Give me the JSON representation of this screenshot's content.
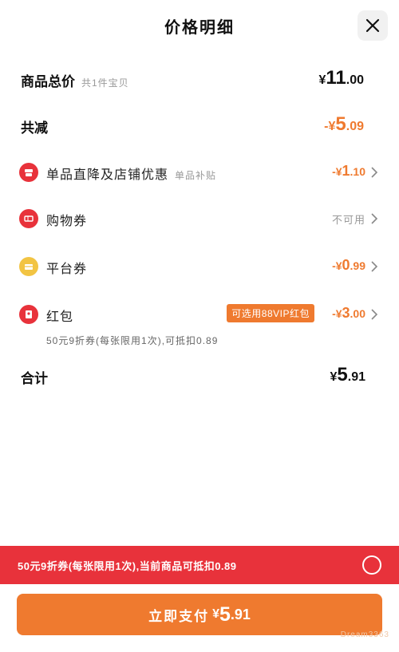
{
  "header": {
    "title": "价格明细",
    "close_icon": "close-icon"
  },
  "summary": {
    "goods_total_label": "商品总价",
    "goods_total_sub": "共1件宝贝",
    "goods_total_symbol": "¥",
    "goods_total_int": "11",
    "goods_total_dec": ".00",
    "discount_label": "共减",
    "discount_prefix": "-¥",
    "discount_int": "5",
    "discount_dec": ".09"
  },
  "items": [
    {
      "icon": "shop-discount-icon",
      "icon_color": "#e8323b",
      "label": "单品直降及店铺优惠",
      "sub": "单品补贴",
      "prefix": "-¥",
      "int": "1",
      "dec": ".10"
    },
    {
      "icon": "coupon-icon",
      "icon_color": "#e8323b",
      "label": "购物券",
      "status": "不可用"
    },
    {
      "icon": "platform-coupon-icon",
      "icon_color": "#f2c443",
      "label": "平台券",
      "prefix": "-¥",
      "int": "0",
      "dec": ".99"
    },
    {
      "icon": "red-packet-icon",
      "icon_color": "#e8323b",
      "label": "红包",
      "badge": "可选用88VIP红包",
      "prefix": "-¥",
      "int": "3",
      "dec": ".00"
    }
  ],
  "red_packet_note": "50元9折券(每张限用1次),可抵扣0.89",
  "total": {
    "label": "合计",
    "symbol": "¥",
    "int": "5",
    "dec": ".91"
  },
  "promo": {
    "text": "50元9折券(每张限用1次),当前商品可抵扣0.89"
  },
  "pay_button": {
    "label": "立即支付",
    "symbol": "¥",
    "int": "5",
    "dec": ".91"
  },
  "watermark": "Dream3363",
  "colors": {
    "accent_orange": "#ef7a2f",
    "promo_red": "#e8323b",
    "icon_yellow": "#f2c443"
  }
}
